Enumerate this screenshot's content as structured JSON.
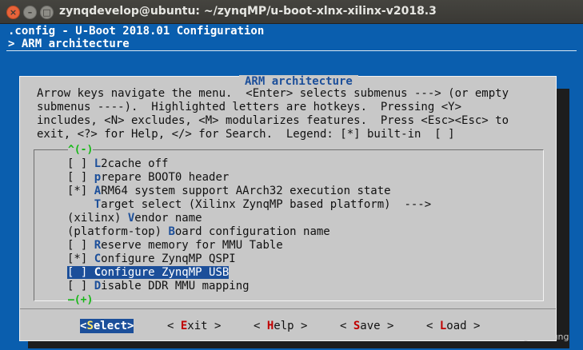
{
  "window": {
    "title": "zynqdevelop@ubuntu: ~/zynqMP/u-boot-xlnx-xilinx-v2018.3",
    "close_glyph": "×",
    "minimize_glyph": "–",
    "maximize_glyph": "□"
  },
  "terminal": {
    "config_line": ".config - U-Boot 2018.01 Configuration",
    "breadcrumb": "> ARM architecture"
  },
  "dialog": {
    "title": "ARM architecture",
    "help_text": "Arrow keys navigate the menu.  <Enter> selects submenus ---> (or empty\nsubmenus ----).  Highlighted letters are hotkeys.  Pressing <Y>\nincludes, <N> excludes, <M> modularizes features.  Press <Esc><Esc> to\nexit, <?> for Help, </> for Search.  Legend: [*] built-in  [ ]",
    "scroll_up": "^(-)",
    "scroll_down": "—(+)",
    "items": [
      {
        "prefix": "[ ] ",
        "hot": "L",
        "rest": "2cache off"
      },
      {
        "prefix": "[ ] ",
        "hot": "p",
        "rest": "repare BOOT0 header"
      },
      {
        "prefix": "[*] ",
        "hot": "A",
        "rest": "RM64 system support AArch32 execution state"
      },
      {
        "prefix": "    ",
        "hot": "T",
        "rest": "arget select (Xilinx ZynqMP based platform)  --->"
      },
      {
        "prefix": "(xilinx) ",
        "hot": "V",
        "rest": "endor name"
      },
      {
        "prefix": "(platform-top) ",
        "hot": "B",
        "rest": "oard configuration name"
      },
      {
        "prefix": "[ ] ",
        "hot": "R",
        "rest": "eserve memory for MMU Table"
      },
      {
        "prefix": "[*] ",
        "hot": "C",
        "rest": "onfigure ZynqMP QSPI"
      },
      {
        "prefix": "[ ] ",
        "hot": "C",
        "rest": "onfigure ZynqMP USB"
      },
      {
        "prefix": "[ ] ",
        "hot": "D",
        "rest": "isable DDR MMU mapping"
      }
    ],
    "selected_index": 8
  },
  "buttons": {
    "select": {
      "open": "<",
      "hot": "S",
      "rest": "elect",
      "close": ">"
    },
    "exit": {
      "open": "< ",
      "hot": "E",
      "rest": "xit",
      "close": " >"
    },
    "help": {
      "open": "< ",
      "hot": "H",
      "rest": "elp",
      "close": " >"
    },
    "save": {
      "open": "< ",
      "hot": "S",
      "rest": "ave",
      "close": " >"
    },
    "load": {
      "open": "< ",
      "hot": "L",
      "rest": "oad",
      "close": " >"
    }
  },
  "watermark": "CSDN @HIKIsung",
  "colors": {
    "terminal_bg": "#0a5eae",
    "dialog_bg": "#c8c8c8",
    "highlight": "#1c4f9a",
    "hotkey_button": "#c00000",
    "scroll_marker": "#14b814",
    "close_button": "#e8633a"
  }
}
